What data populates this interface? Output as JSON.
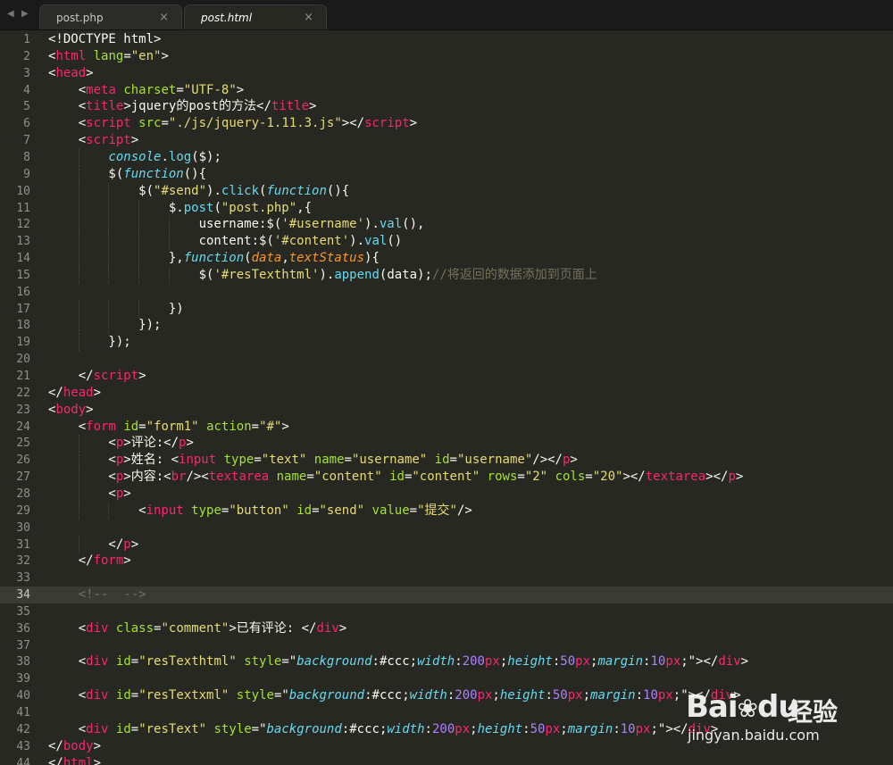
{
  "tabs": [
    {
      "label": "post.php",
      "close": "×",
      "active": false
    },
    {
      "label": "post.html",
      "close": "×",
      "active": true
    }
  ],
  "nav": {
    "back": "◀",
    "forward": "▶"
  },
  "editor": {
    "current_line": 34,
    "lines": [
      [
        [
          "p",
          "<!DOCTYPE html>"
        ]
      ],
      [
        [
          "p",
          "<"
        ],
        [
          "t",
          "html"
        ],
        [
          "p",
          " "
        ],
        [
          "a",
          "lang"
        ],
        [
          "p",
          "="
        ],
        [
          "s",
          "\"en\""
        ],
        [
          "p",
          ">"
        ]
      ],
      [
        [
          "p",
          "<"
        ],
        [
          "t",
          "head"
        ],
        [
          "p",
          ">"
        ]
      ],
      [
        [
          "p",
          "    <"
        ],
        [
          "t",
          "meta"
        ],
        [
          "p",
          " "
        ],
        [
          "a",
          "charset"
        ],
        [
          "p",
          "="
        ],
        [
          "s",
          "\"UTF-8\""
        ],
        [
          "p",
          ">"
        ]
      ],
      [
        [
          "p",
          "    <"
        ],
        [
          "t",
          "title"
        ],
        [
          "p",
          ">jquery的post的方法</"
        ],
        [
          "t",
          "title"
        ],
        [
          "p",
          ">"
        ]
      ],
      [
        [
          "p",
          "    <"
        ],
        [
          "t",
          "script"
        ],
        [
          "p",
          " "
        ],
        [
          "a",
          "src"
        ],
        [
          "p",
          "="
        ],
        [
          "s",
          "\"./js/jquery-1.11.3.js\""
        ],
        [
          "p",
          "></"
        ],
        [
          "t",
          "script"
        ],
        [
          "p",
          ">"
        ]
      ],
      [
        [
          "p",
          "    <"
        ],
        [
          "t",
          "script"
        ],
        [
          "p",
          ">"
        ]
      ],
      [
        [
          "p",
          "        "
        ],
        [
          "f",
          "console"
        ],
        [
          "p",
          "."
        ],
        [
          "y",
          "log"
        ],
        [
          "p",
          "($);"
        ]
      ],
      [
        [
          "p",
          "        $("
        ],
        [
          "f",
          "function"
        ],
        [
          "p",
          "(){"
        ]
      ],
      [
        [
          "p",
          "            $("
        ],
        [
          "s",
          "\"#send\""
        ],
        [
          "p",
          ")."
        ],
        [
          "y",
          "click"
        ],
        [
          "p",
          "("
        ],
        [
          "f",
          "function"
        ],
        [
          "p",
          "(){"
        ]
      ],
      [
        [
          "p",
          "                $."
        ],
        [
          "y",
          "post"
        ],
        [
          "p",
          "("
        ],
        [
          "s",
          "\"post.php\""
        ],
        [
          "p",
          ",{"
        ]
      ],
      [
        [
          "p",
          "                    username:$("
        ],
        [
          "s",
          "'#username'"
        ],
        [
          "p",
          ")."
        ],
        [
          "y",
          "val"
        ],
        [
          "p",
          "(),"
        ]
      ],
      [
        [
          "p",
          "                    content:$("
        ],
        [
          "s",
          "'#content'"
        ],
        [
          "p",
          ")."
        ],
        [
          "y",
          "val"
        ],
        [
          "p",
          "()"
        ]
      ],
      [
        [
          "p",
          "                },"
        ],
        [
          "f",
          "function"
        ],
        [
          "p",
          "("
        ],
        [
          "p2",
          "data"
        ],
        [
          "p",
          ","
        ],
        [
          "p2",
          "textStatus"
        ],
        [
          "p",
          "){"
        ]
      ],
      [
        [
          "p",
          "                    $("
        ],
        [
          "s",
          "'#resTexthtml'"
        ],
        [
          "p",
          ")."
        ],
        [
          "y",
          "append"
        ],
        [
          "p",
          "(data);"
        ],
        [
          "c",
          "//将返回的数据添加到页面上"
        ]
      ],
      [
        [
          "p",
          ""
        ]
      ],
      [
        [
          "p",
          "                })"
        ]
      ],
      [
        [
          "p",
          "            });"
        ]
      ],
      [
        [
          "p",
          "        });"
        ]
      ],
      [
        [
          "p",
          ""
        ]
      ],
      [
        [
          "p",
          "    </"
        ],
        [
          "t",
          "script"
        ],
        [
          "p",
          ">"
        ]
      ],
      [
        [
          "p",
          "</"
        ],
        [
          "t",
          "head"
        ],
        [
          "p",
          ">"
        ]
      ],
      [
        [
          "p",
          "<"
        ],
        [
          "t",
          "body"
        ],
        [
          "p",
          ">"
        ]
      ],
      [
        [
          "p",
          "    <"
        ],
        [
          "t",
          "form"
        ],
        [
          "p",
          " "
        ],
        [
          "a",
          "id"
        ],
        [
          "p",
          "="
        ],
        [
          "s",
          "\"form1\""
        ],
        [
          "p",
          " "
        ],
        [
          "a",
          "action"
        ],
        [
          "p",
          "="
        ],
        [
          "s",
          "\"#\""
        ],
        [
          "p",
          ">"
        ]
      ],
      [
        [
          "p",
          "        <"
        ],
        [
          "t",
          "p"
        ],
        [
          "p",
          ">评论:</"
        ],
        [
          "t",
          "p"
        ],
        [
          "p",
          ">"
        ]
      ],
      [
        [
          "p",
          "        <"
        ],
        [
          "t",
          "p"
        ],
        [
          "p",
          ">姓名: <"
        ],
        [
          "t",
          "input"
        ],
        [
          "p",
          " "
        ],
        [
          "a",
          "type"
        ],
        [
          "p",
          "="
        ],
        [
          "s",
          "\"text\""
        ],
        [
          "p",
          " "
        ],
        [
          "a",
          "name"
        ],
        [
          "p",
          "="
        ],
        [
          "s",
          "\"username\""
        ],
        [
          "p",
          " "
        ],
        [
          "a",
          "id"
        ],
        [
          "p",
          "="
        ],
        [
          "s",
          "\"username\""
        ],
        [
          "p",
          "/></"
        ],
        [
          "t",
          "p"
        ],
        [
          "p",
          ">"
        ]
      ],
      [
        [
          "p",
          "        <"
        ],
        [
          "t",
          "p"
        ],
        [
          "p",
          ">内容:<"
        ],
        [
          "t",
          "br"
        ],
        [
          "p",
          "/><"
        ],
        [
          "t",
          "textarea"
        ],
        [
          "p",
          " "
        ],
        [
          "a",
          "name"
        ],
        [
          "p",
          "="
        ],
        [
          "s",
          "\"content\""
        ],
        [
          "p",
          " "
        ],
        [
          "a",
          "id"
        ],
        [
          "p",
          "="
        ],
        [
          "s",
          "\"content\""
        ],
        [
          "p",
          " "
        ],
        [
          "a",
          "rows"
        ],
        [
          "p",
          "="
        ],
        [
          "s",
          "\"2\""
        ],
        [
          "p",
          " "
        ],
        [
          "a",
          "cols"
        ],
        [
          "p",
          "="
        ],
        [
          "s",
          "\"20\""
        ],
        [
          "p",
          "></"
        ],
        [
          "t",
          "textarea"
        ],
        [
          "p",
          "></"
        ],
        [
          "t",
          "p"
        ],
        [
          "p",
          ">"
        ]
      ],
      [
        [
          "p",
          "        <"
        ],
        [
          "t",
          "p"
        ],
        [
          "p",
          ">"
        ]
      ],
      [
        [
          "p",
          "            <"
        ],
        [
          "t",
          "input"
        ],
        [
          "p",
          " "
        ],
        [
          "a",
          "type"
        ],
        [
          "p",
          "="
        ],
        [
          "s",
          "\"button\""
        ],
        [
          "p",
          " "
        ],
        [
          "a",
          "id"
        ],
        [
          "p",
          "="
        ],
        [
          "s",
          "\"send\""
        ],
        [
          "p",
          " "
        ],
        [
          "a",
          "value"
        ],
        [
          "p",
          "="
        ],
        [
          "s",
          "\"提交\""
        ],
        [
          "p",
          "/>"
        ]
      ],
      [
        [
          "p",
          ""
        ]
      ],
      [
        [
          "p",
          "        </"
        ],
        [
          "t",
          "p"
        ],
        [
          "p",
          ">"
        ]
      ],
      [
        [
          "p",
          "    </"
        ],
        [
          "t",
          "form"
        ],
        [
          "p",
          ">"
        ]
      ],
      [
        [
          "p",
          ""
        ]
      ],
      [
        [
          "c",
          "    <!--  -->"
        ]
      ],
      [
        [
          "p",
          ""
        ]
      ],
      [
        [
          "p",
          "    <"
        ],
        [
          "t",
          "div"
        ],
        [
          "p",
          " "
        ],
        [
          "a",
          "class"
        ],
        [
          "p",
          "="
        ],
        [
          "s",
          "\"comment\""
        ],
        [
          "p",
          ">已有评论: </"
        ],
        [
          "t",
          "div"
        ],
        [
          "p",
          ">"
        ]
      ],
      [
        [
          "p",
          ""
        ]
      ],
      [
        [
          "p",
          "    <"
        ],
        [
          "t",
          "div"
        ],
        [
          "p",
          " "
        ],
        [
          "a",
          "id"
        ],
        [
          "p",
          "="
        ],
        [
          "s",
          "\"resTexthtml\""
        ],
        [
          "p",
          " "
        ],
        [
          "a",
          "style"
        ],
        [
          "p",
          "=\""
        ],
        [
          "f",
          "background"
        ],
        [
          "p",
          ":#ccc;"
        ],
        [
          "f",
          "width"
        ],
        [
          "p",
          ":"
        ],
        [
          "n",
          "200"
        ],
        [
          "t",
          "px"
        ],
        [
          "p",
          ";"
        ],
        [
          "f",
          "height"
        ],
        [
          "p",
          ":"
        ],
        [
          "n",
          "50"
        ],
        [
          "t",
          "px"
        ],
        [
          "p",
          ";"
        ],
        [
          "f",
          "margin"
        ],
        [
          "p",
          ":"
        ],
        [
          "n",
          "10"
        ],
        [
          "t",
          "px"
        ],
        [
          "p",
          ";\"></"
        ],
        [
          "t",
          "div"
        ],
        [
          "p",
          ">"
        ]
      ],
      [
        [
          "p",
          ""
        ]
      ],
      [
        [
          "p",
          "    <"
        ],
        [
          "t",
          "div"
        ],
        [
          "p",
          " "
        ],
        [
          "a",
          "id"
        ],
        [
          "p",
          "="
        ],
        [
          "s",
          "\"resTextxml\""
        ],
        [
          "p",
          " "
        ],
        [
          "a",
          "style"
        ],
        [
          "p",
          "=\""
        ],
        [
          "f",
          "background"
        ],
        [
          "p",
          ":#ccc;"
        ],
        [
          "f",
          "width"
        ],
        [
          "p",
          ":"
        ],
        [
          "n",
          "200"
        ],
        [
          "t",
          "px"
        ],
        [
          "p",
          ";"
        ],
        [
          "f",
          "height"
        ],
        [
          "p",
          ":"
        ],
        [
          "n",
          "50"
        ],
        [
          "t",
          "px"
        ],
        [
          "p",
          ";"
        ],
        [
          "f",
          "margin"
        ],
        [
          "p",
          ":"
        ],
        [
          "n",
          "10"
        ],
        [
          "t",
          "px"
        ],
        [
          "p",
          ";\"></"
        ],
        [
          "t",
          "div"
        ],
        [
          "p",
          ">"
        ]
      ],
      [
        [
          "p",
          ""
        ]
      ],
      [
        [
          "p",
          "    <"
        ],
        [
          "t",
          "div"
        ],
        [
          "p",
          " "
        ],
        [
          "a",
          "id"
        ],
        [
          "p",
          "="
        ],
        [
          "s",
          "\"resText\""
        ],
        [
          "p",
          " "
        ],
        [
          "a",
          "style"
        ],
        [
          "p",
          "=\""
        ],
        [
          "f",
          "background"
        ],
        [
          "p",
          ":#ccc;"
        ],
        [
          "f",
          "width"
        ],
        [
          "p",
          ":"
        ],
        [
          "n",
          "200"
        ],
        [
          "t",
          "px"
        ],
        [
          "p",
          ";"
        ],
        [
          "f",
          "height"
        ],
        [
          "p",
          ":"
        ],
        [
          "n",
          "50"
        ],
        [
          "t",
          "px"
        ],
        [
          "p",
          ";"
        ],
        [
          "f",
          "margin"
        ],
        [
          "p",
          ":"
        ],
        [
          "n",
          "10"
        ],
        [
          "t",
          "px"
        ],
        [
          "p",
          ";\"></"
        ],
        [
          "t",
          "div"
        ],
        [
          "p",
          ">"
        ]
      ],
      [
        [
          "p",
          "</"
        ],
        [
          "t",
          "body"
        ],
        [
          "p",
          ">"
        ]
      ],
      [
        [
          "p",
          "</"
        ],
        [
          "t",
          "html"
        ],
        [
          "p",
          ">"
        ]
      ]
    ]
  },
  "watermark": {
    "brand": "Bai",
    "brand_suffix": "du",
    "cn": "经验",
    "url": "jingyan.baidu.com"
  }
}
